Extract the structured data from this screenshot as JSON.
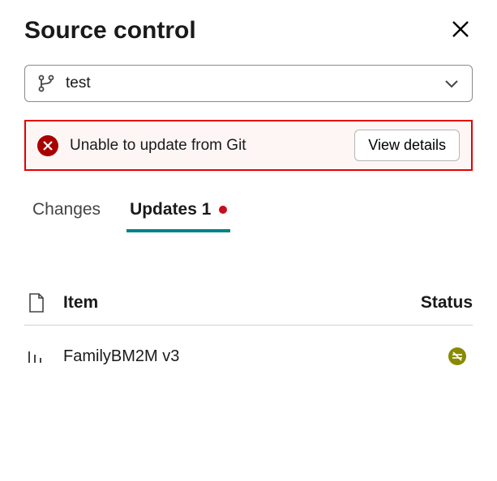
{
  "header": {
    "title": "Source control"
  },
  "branch": {
    "name": "test"
  },
  "error": {
    "message": "Unable to update from Git",
    "action_label": "View details"
  },
  "tabs": [
    {
      "label": "Changes",
      "active": false,
      "has_indicator": false
    },
    {
      "label": "Updates 1",
      "active": true,
      "has_indicator": true
    }
  ],
  "list": {
    "columns": {
      "item": "Item",
      "status": "Status"
    },
    "rows": [
      {
        "name": "FamilyBM2M v3",
        "icon": "bar-chart",
        "status": "conflict"
      }
    ]
  }
}
